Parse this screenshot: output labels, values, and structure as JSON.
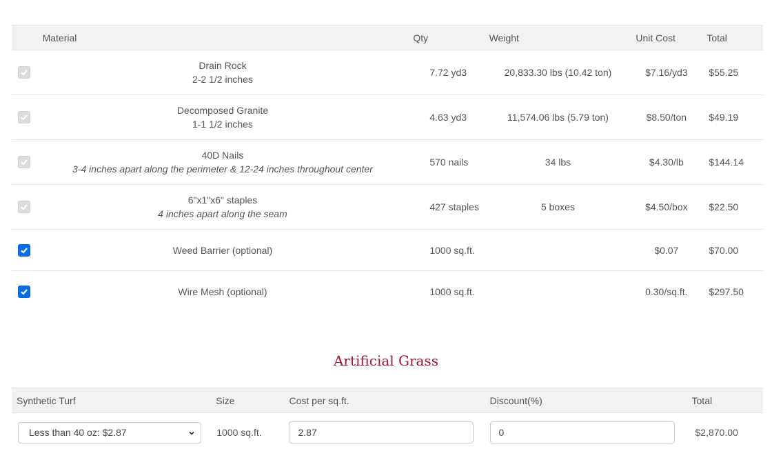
{
  "materials": {
    "headers": {
      "material": "Material",
      "qty": "Qty",
      "weight": "Weight",
      "unit_cost": "Unit Cost",
      "total": "Total"
    },
    "rows": [
      {
        "checked": true,
        "disabled": true,
        "name": "Drain Rock",
        "detail": "2-2 1/2 inches",
        "detail_italic": false,
        "qty": "7.72 yd3",
        "weight": "20,833.30 lbs (10.42 ton)",
        "unit_cost": "$7.16/yd3",
        "total": "$55.25"
      },
      {
        "checked": true,
        "disabled": true,
        "name": "Decomposed Granite",
        "detail": "1-1 1/2 inches",
        "detail_italic": false,
        "qty": "4.63 yd3",
        "weight": "11,574.06 lbs (5.79 ton)",
        "unit_cost": "$8.50/ton",
        "total": "$49.19"
      },
      {
        "checked": true,
        "disabled": true,
        "name": "40D Nails",
        "detail": "3-4 inches apart along the perimeter & 12-24 inches throughout center",
        "detail_italic": true,
        "qty": "570 nails",
        "weight": "34 lbs",
        "unit_cost": "$4.30/lb",
        "total": "$144.14"
      },
      {
        "checked": true,
        "disabled": true,
        "name": "6\"x1\"x6\" staples",
        "detail": "4 inches apart along the seam",
        "detail_italic": true,
        "qty": "427 staples",
        "weight": "5 boxes",
        "unit_cost": "$4.50/box",
        "total": "$22.50"
      },
      {
        "checked": true,
        "disabled": false,
        "name": "Weed Barrier (optional)",
        "qty": "1000 sq.ft.",
        "weight": "",
        "unit_cost": "$0.07",
        "total": "$70.00"
      },
      {
        "checked": true,
        "disabled": false,
        "name": "Wire Mesh (optional)",
        "qty": "1000 sq.ft.",
        "weight": "",
        "unit_cost": "0.30/sq.ft.",
        "total": "$297.50"
      }
    ]
  },
  "grass": {
    "title": "Artificial Grass",
    "headers": {
      "turf": "Synthetic Turf",
      "size": "Size",
      "cost": "Cost per sq.ft.",
      "discount": "Discount(%)",
      "total": "Total"
    },
    "turf_selected": "Less than 40 oz: $2.87",
    "size": "1000 sq.ft.",
    "cost_value": "2.87",
    "discount_value": "0",
    "total": "$2,870.00"
  },
  "colors": {
    "accent_title": "#a0142c",
    "checkbox_checked": "#0b6ee8",
    "header_bg": "#f2f2f2"
  }
}
